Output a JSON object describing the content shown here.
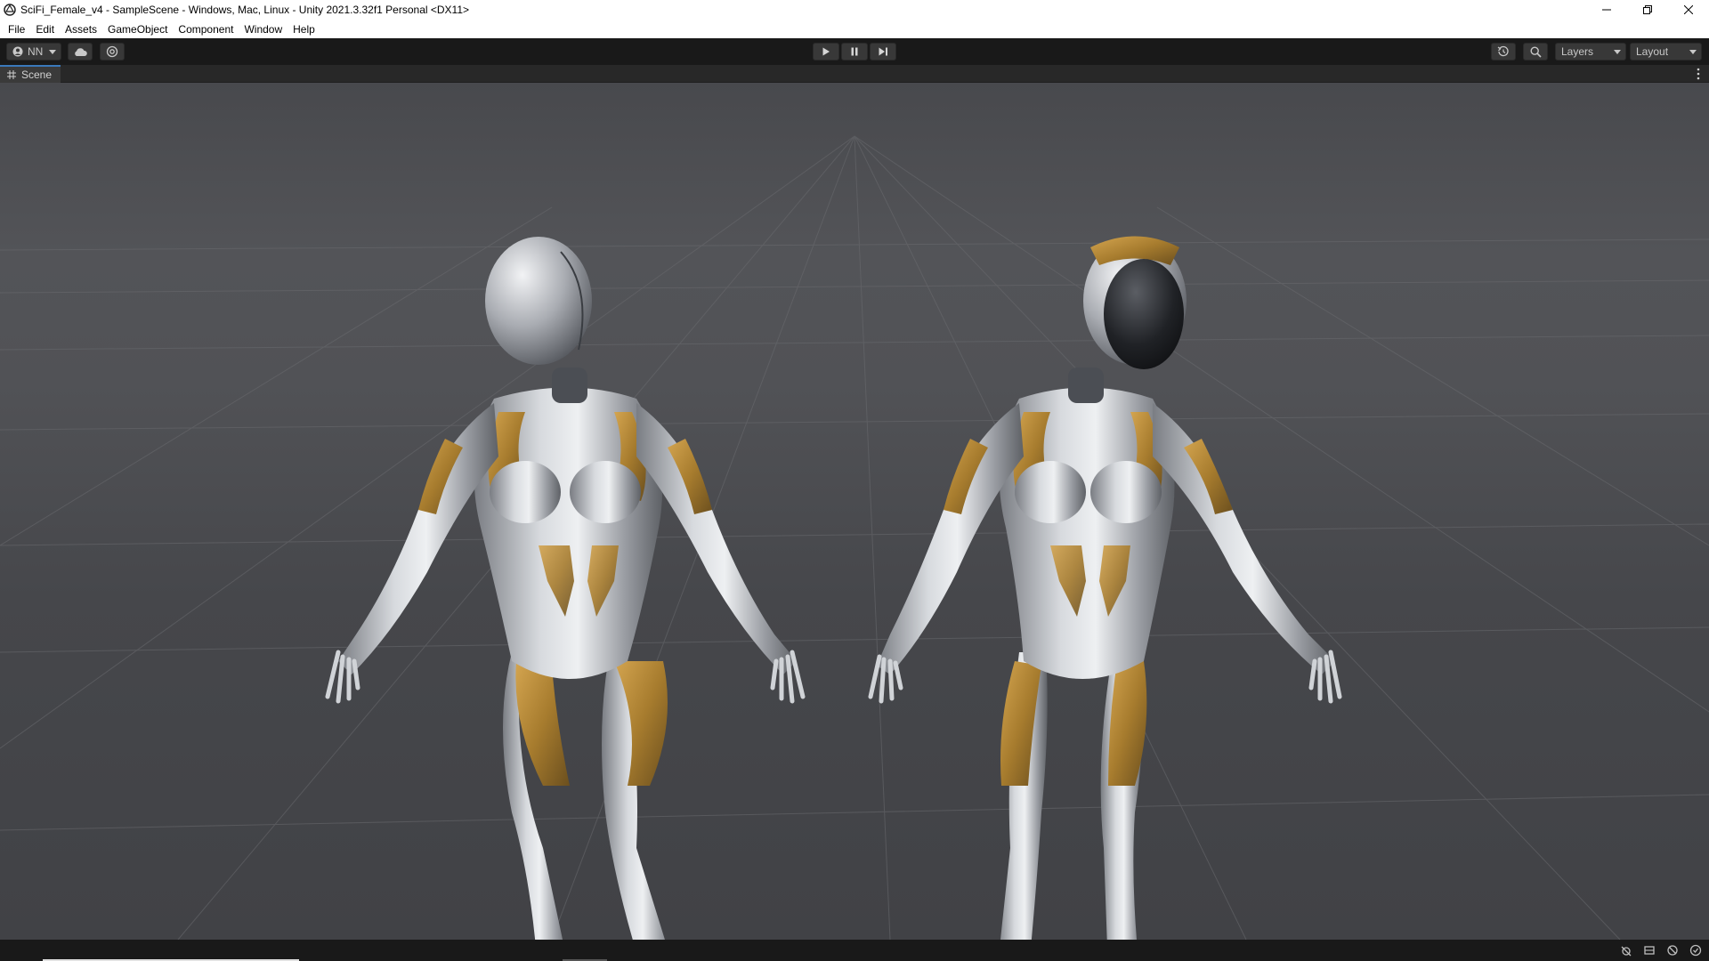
{
  "window": {
    "title": "SciFi_Female_v4 - SampleScene - Windows, Mac, Linux - Unity 2021.3.32f1 Personal <DX11>"
  },
  "menu": {
    "items": [
      "File",
      "Edit",
      "Assets",
      "GameObject",
      "Component",
      "Window",
      "Help"
    ]
  },
  "toolbar": {
    "account_label": "NN",
    "layers_label": "Layers",
    "layout_label": "Layout"
  },
  "scene_tab": {
    "label": "Scene"
  },
  "colors": {
    "accent": "#3a79bb",
    "toolbar_bg": "#191919",
    "viewport_bg": "#4a4b4f",
    "suit_silver": "#b9bcc2",
    "suit_gold": "#b58a3a"
  },
  "icons": {
    "app": "unity-logo-icon",
    "play": "play-icon",
    "pause": "pause-icon",
    "step": "step-icon",
    "history": "history-icon",
    "search": "search-icon",
    "cloud": "cloud-icon",
    "collab": "collab-icon"
  }
}
